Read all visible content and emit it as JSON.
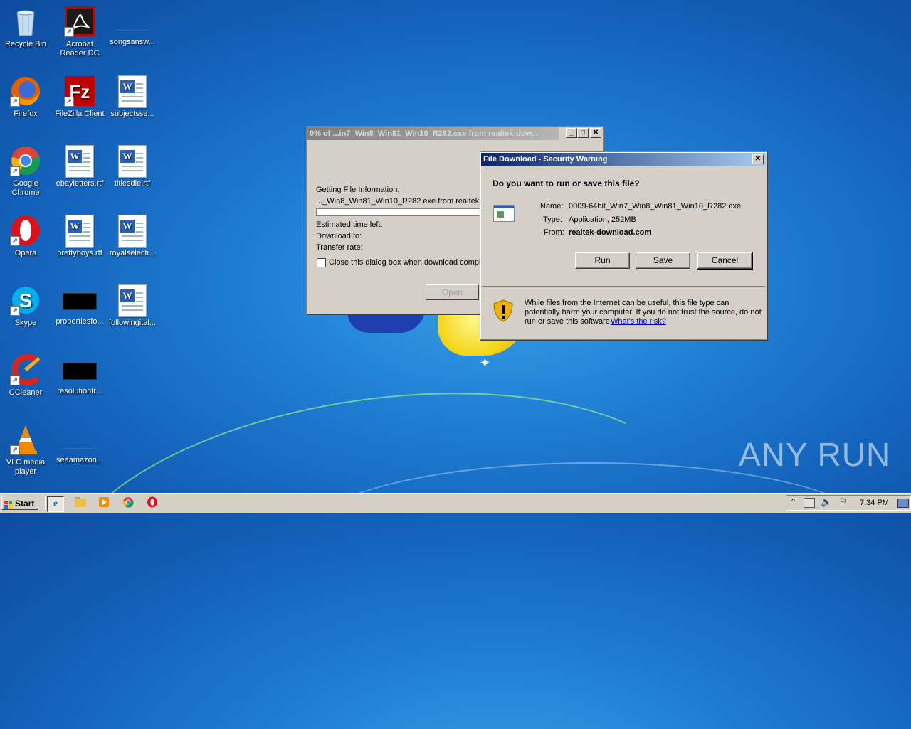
{
  "desktop": {
    "icons": [
      {
        "label": "Recycle Bin"
      },
      {
        "label": "Acrobat Reader DC"
      },
      {
        "label": "songsansw..."
      },
      {
        "label": "Firefox"
      },
      {
        "label": "FileZilla Client"
      },
      {
        "label": "subjectsse..."
      },
      {
        "label": "Google Chrome"
      },
      {
        "label": "ebayletters.rtf"
      },
      {
        "label": "titlesdie.rtf"
      },
      {
        "label": "Opera"
      },
      {
        "label": "prettyboys.rtf"
      },
      {
        "label": "royalselecti..."
      },
      {
        "label": "Skype"
      },
      {
        "label": "propertiesfo..."
      },
      {
        "label": "followingital..."
      },
      {
        "label": "CCleaner"
      },
      {
        "label": "resolutiontr..."
      },
      {
        "label": "VLC media player"
      },
      {
        "label": "seaamazon..."
      }
    ],
    "watermark": "ANY RUN"
  },
  "progress_dialog": {
    "title": "0% of ...in7_Win8_Win81_Win10_R282.exe from realtek-dow...",
    "getting_info": "Getting File Information:",
    "filename": "..._Win8_Win81_Win10_R282.exe from realtek-",
    "estimated": "Estimated time left:",
    "download_to": "Download to:",
    "transfer_rate": "Transfer rate:",
    "close_checkbox": "Close this dialog box when download comple",
    "open_button": "Open",
    "progress_percent": 0
  },
  "security_dialog": {
    "title": "File Download - Security Warning",
    "question": "Do you want to run or save this file?",
    "name_label": "Name:",
    "name_value": "0009-64bit_Win7_Win8_Win81_Win10_R282.exe",
    "type_label": "Type:",
    "type_value": "Application, 252MB",
    "from_label": "From:",
    "from_value": "realtek-download.com",
    "run_button": "Run",
    "save_button": "Save",
    "cancel_button": "Cancel",
    "warning_text_1": "While files from the Internet can be useful, this file type can",
    "warning_text_2": "potentially harm your computer. If you do not trust the source, do not",
    "warning_text_3": "run or save this software.",
    "risk_link": "What's the risk?"
  },
  "taskbar": {
    "start_label": "Start",
    "clock": "7:34 PM"
  }
}
